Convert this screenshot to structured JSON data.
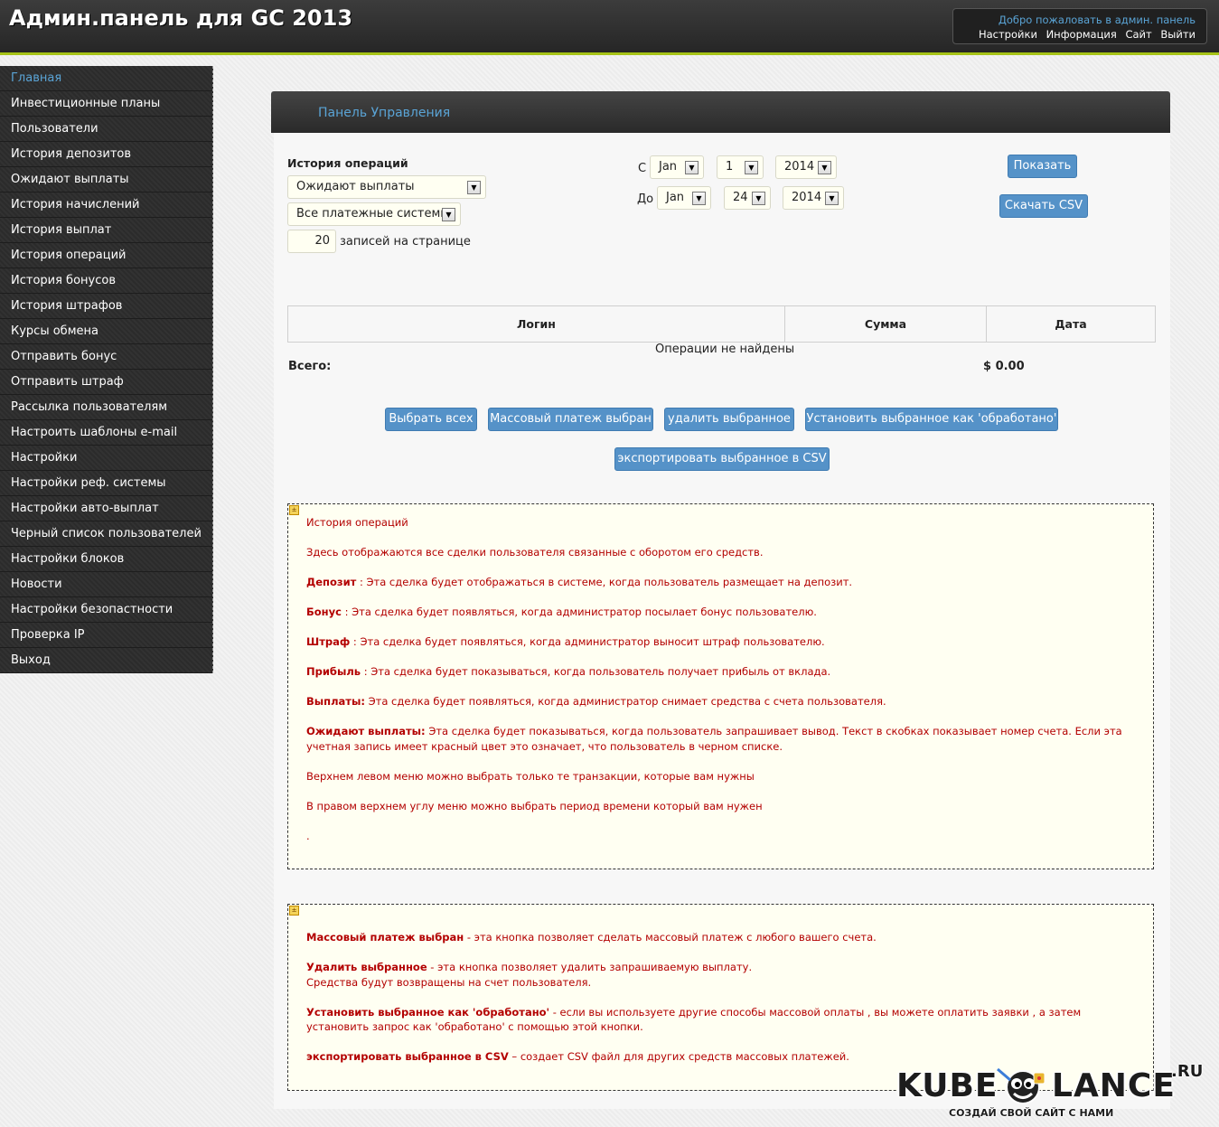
{
  "header": {
    "title": "Админ.панель для GC 2013",
    "welcome": "Добро пожаловать в админ. панель",
    "links": [
      "Настройки",
      "Информация",
      "Сайт",
      "Выйти"
    ]
  },
  "sidebar": {
    "items": [
      {
        "label": "Главная",
        "active": true
      },
      {
        "label": "Инвестиционные планы"
      },
      {
        "label": "Пользователи"
      },
      {
        "label": "История депозитов"
      },
      {
        "label": "Ожидают выплаты"
      },
      {
        "label": "История начислений"
      },
      {
        "label": "История выплат"
      },
      {
        "label": "История операций"
      },
      {
        "label": "История бонусов"
      },
      {
        "label": "История штрафов"
      },
      {
        "label": "Курсы обмена"
      },
      {
        "label": "Отправить бонус"
      },
      {
        "label": "Отправить штраф"
      },
      {
        "label": "Рассылка пользователям"
      },
      {
        "label": "Настроить шаблоны e-mail"
      },
      {
        "label": "Настройки"
      },
      {
        "label": "Настройки реф. системы"
      },
      {
        "label": "Настройки авто-выплат"
      },
      {
        "label": "Черный список пользователей"
      },
      {
        "label": "Настройки блоков"
      },
      {
        "label": "Новости"
      },
      {
        "label": "Настройки безопастности"
      },
      {
        "label": "Проверка IP"
      },
      {
        "label": "Выход"
      }
    ]
  },
  "panel": {
    "title": "Панель Управления"
  },
  "filters": {
    "section_label": "История операций",
    "type_select": "Ожидают выплаты",
    "system_select": "Все платежные системы",
    "per_page_value": "20",
    "per_page_label": "записей на странице",
    "from_label": "С",
    "to_label": "До",
    "from": {
      "month": "Jan",
      "day": "1",
      "year": "2014"
    },
    "to": {
      "month": "Jan",
      "day": "24",
      "year": "2014"
    },
    "show_button": "Показать",
    "csv_button": "Скачать CSV"
  },
  "table": {
    "columns": [
      "Логин",
      "Сумма",
      "Дата"
    ],
    "empty_message": "Операции не найдены",
    "total_label": "Всего:",
    "total_value": "$ 0.00"
  },
  "actions": {
    "select_all": "Выбрать всех",
    "mass_pay": "Массовый платеж выбран",
    "delete_selected": "удалить выбранное",
    "mark_processed": "Установить выбранное как 'обработано'",
    "export_csv": "экспортировать выбранное в CSV"
  },
  "info1": {
    "heading": "История операций",
    "intro": "Здесь отображаются все сделки пользователя связанные с оборотом его средств.",
    "entries": [
      {
        "term": "Депозит",
        "sep": " : ",
        "text": "Эта сделка будет отображаться в системе, когда пользователь размещает на депозит."
      },
      {
        "term": "Бонус",
        "sep": " : ",
        "text": "Эта сделка будет появляться, когда администратор посылает бонус пользователю."
      },
      {
        "term": "Штраф",
        "sep": " : ",
        "text": "Эта сделка будет появляться, когда администратор выносит штраф пользователю."
      },
      {
        "term": "Прибыль",
        "sep": " : ",
        "text": "Эта сделка будет показываться, когда пользователь получает прибыль от вклада."
      },
      {
        "term": "Выплаты:",
        "sep": " ",
        "text": "Эта сделка будет появляться, когда администратор снимает средства с счета пользователя."
      },
      {
        "term": "Ожидают выплаты:",
        "sep": " ",
        "text": "Эта сделка будет показываться, когда пользователь запрашивает вывод. Текст в скобках показывает номер счета. Если эта учетная запись имеет красный цвет это означает, что пользователь в черном списке."
      }
    ],
    "note1": "Верхнем левом меню можно выбрать только те транзакции, которые вам нужны",
    "note2": "В правом верхнем углу меню можно выбрать период времени который вам нужен",
    "dot": "."
  },
  "info2": {
    "entries": [
      {
        "term": "Массовый платеж выбран",
        "text": " - эта кнопка позволяет сделать массовый платеж с любого вашего счета."
      },
      {
        "term": "Удалить выбранное",
        "text": " - эта кнопка позволяет удалить запрашиваемую выплату.",
        "text2": "Средства будут возвращены на счет пользователя."
      },
      {
        "term": "Установить выбранное как 'обработано'",
        "text": " - если вы используете другие способы массовой оплаты , вы можете оплатить заявки , а затем установить запрос как 'обработано' с помощью этой кнопки."
      },
      {
        "term": "экспортировать выбранное в CSV",
        "text": " – создает CSV файл для других средств массовых платежей."
      }
    ]
  },
  "watermark": {
    "part1": "KUBE",
    "part2": "LANCE",
    "suffix": ".RU",
    "tagline": "СОЗДАЙ СВОЙ САЙТ С НАМИ"
  },
  "colors": {
    "accent": "#5aa4d6",
    "button": "#5592c8",
    "header_stripe": "#a6c317",
    "info_text": "#b30000"
  }
}
